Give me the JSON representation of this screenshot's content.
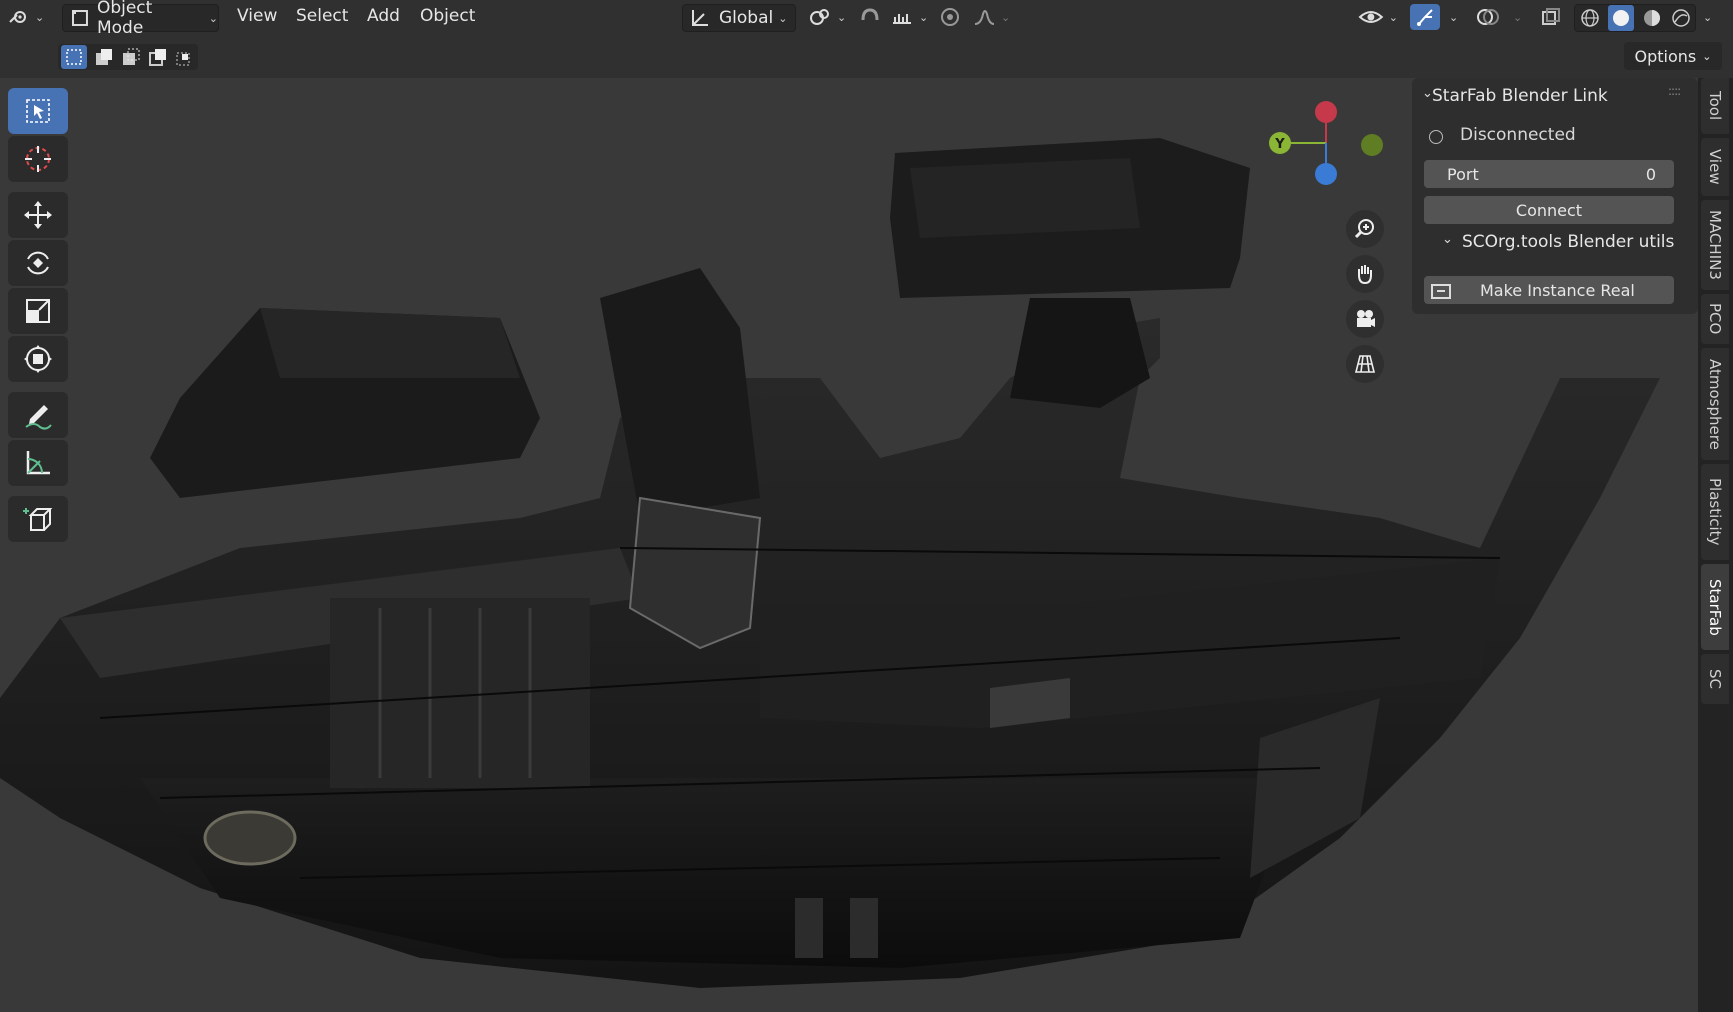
{
  "header": {
    "mode_label": "Object Mode",
    "menus": [
      "View",
      "Select",
      "Add",
      "Object"
    ],
    "transform_orientation": "Global",
    "options_label": "Options"
  },
  "panel": {
    "starfab_title": "StarFab Blender Link",
    "status": "Disconnected",
    "port_label": "Port",
    "port_value": "0",
    "connect_label": "Connect",
    "scorg_title": "SCOrg.tools Blender utils",
    "make_instance_label": "Make Instance Real"
  },
  "gizmo": {
    "y_label": "Y",
    "colors": {
      "x": "#c5394a",
      "y": "#8bb534",
      "z": "#3a7bd5"
    }
  },
  "sidebar_tabs": [
    "Tool",
    "View",
    "MACHIN3",
    "PCO",
    "Atmosphere",
    "Plasticity",
    "StarFab",
    "SC"
  ],
  "active_tab": "StarFab",
  "tool_icons": [
    "select-box-icon",
    "cursor-icon",
    "move-icon",
    "rotate-icon",
    "scale-icon",
    "transform-icon",
    "annotate-icon",
    "measure-icon",
    "add-cube-icon"
  ],
  "colors": {
    "accent": "#4772b3",
    "background": "#303030",
    "viewport": "#393939"
  }
}
